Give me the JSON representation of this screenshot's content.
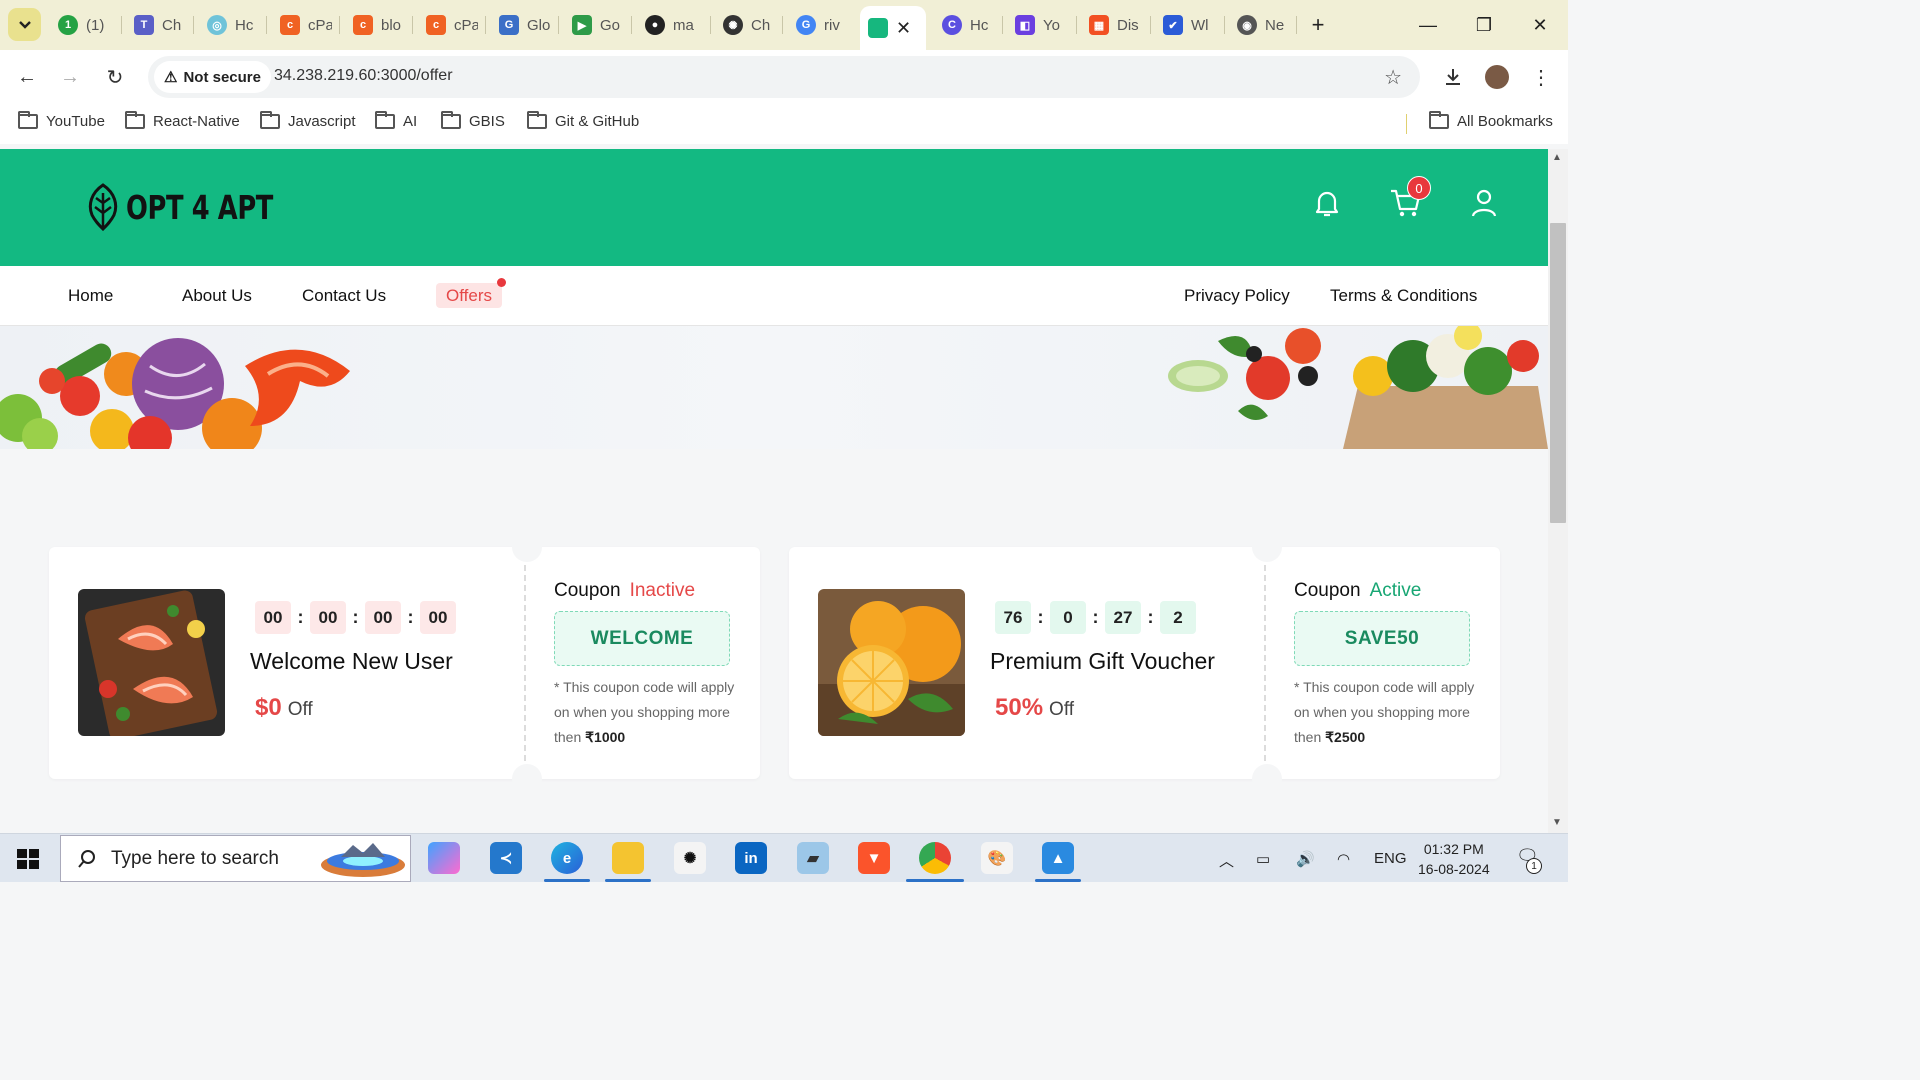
{
  "browser": {
    "tabs": [
      {
        "label": "(1)",
        "color": "#25a244",
        "glyph": "1"
      },
      {
        "label": "Ch",
        "color": "#5a5fc7",
        "glyph": "T"
      },
      {
        "label": "Hc",
        "color": "#6fc3d9",
        "glyph": "◎"
      },
      {
        "label": "cPa",
        "color": "#f06223",
        "glyph": "c"
      },
      {
        "label": "blo",
        "color": "#f06223",
        "glyph": "c"
      },
      {
        "label": "cPa",
        "color": "#f06223",
        "glyph": "c"
      },
      {
        "label": "Glo",
        "color": "#3b6fc7",
        "glyph": "G"
      },
      {
        "label": "Go",
        "color": "#2e9b48",
        "glyph": "▶"
      },
      {
        "label": "ma",
        "color": "#222222",
        "glyph": "●"
      },
      {
        "label": "Ch",
        "color": "#333333",
        "glyph": "✺"
      },
      {
        "label": "riv",
        "color": "#4285f4",
        "glyph": "G"
      },
      {
        "label": "",
        "color": "#16b77e",
        "glyph": "🛍"
      },
      {
        "label": "Hc",
        "color": "#5b4fe0",
        "glyph": "C"
      },
      {
        "label": "Yo",
        "color": "#6b3fe0",
        "glyph": "◧"
      },
      {
        "label": "Dis",
        "color": "#f25022",
        "glyph": "▦"
      },
      {
        "label": "Wl",
        "color": "#2b5bd7",
        "glyph": "✔"
      },
      {
        "label": "Ne",
        "color": "#555555",
        "glyph": "◉"
      }
    ],
    "security_label": "Not secure",
    "url": "34.238.219.60:3000/offer",
    "bookmarks": [
      "YouTube",
      "React-Native",
      "Javascript",
      "AI",
      "GBIS",
      "Git & GitHub"
    ],
    "all_bookmarks": "All Bookmarks"
  },
  "site": {
    "logo_text": "OPT 4 APT",
    "cart_count": "0",
    "nav": {
      "home": "Home",
      "about": "About Us",
      "contact": "Contact Us",
      "offers": "Offers",
      "privacy": "Privacy Policy",
      "terms": "Terms & Conditions"
    }
  },
  "coupons": [
    {
      "timer": [
        "00",
        "00",
        "00",
        "00"
      ],
      "title": "Welcome New User",
      "amount": "$0",
      "off": "Off",
      "coupon_label": "Coupon",
      "status": "Inactive",
      "status_color": "#e54848",
      "code": "WELCOME",
      "note": "* This coupon code will apply on when you shopping more then",
      "min_amount": "₹1000",
      "timer_bg": "#fde8e8"
    },
    {
      "timer": [
        "76",
        "0",
        "27",
        "2"
      ],
      "title": "Premium Gift Voucher",
      "amount": "50%",
      "off": "Off",
      "coupon_label": "Coupon",
      "status": "Active",
      "status_color": "#17a673",
      "code": "SAVE50",
      "note": "* This coupon code will apply on when you shopping more then",
      "min_amount": "₹2500",
      "timer_bg": "#e3f8ee"
    }
  ],
  "taskbar": {
    "search_placeholder": "Type here to search",
    "language": "ENG",
    "time": "01:32 PM",
    "date": "16-08-2024",
    "notification_count": "1"
  }
}
